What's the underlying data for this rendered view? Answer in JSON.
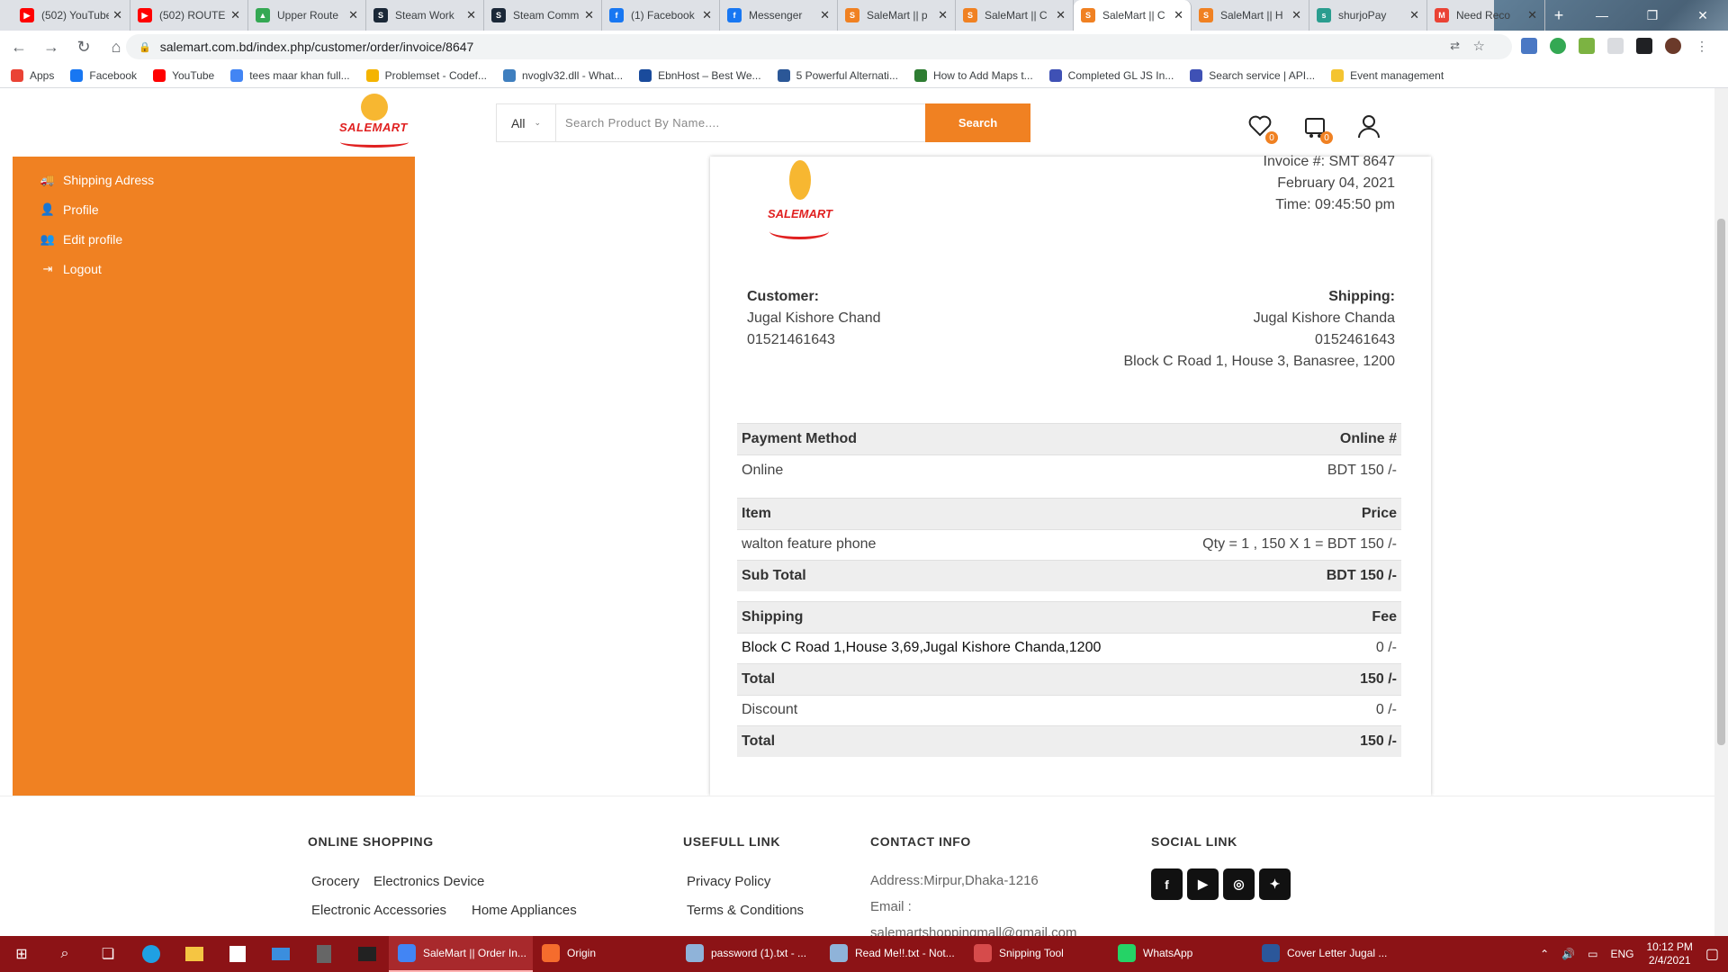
{
  "browser": {
    "tabs": [
      {
        "title": "(502) YouTube",
        "color": "#ff0000",
        "glyph": "▶"
      },
      {
        "title": "(502) ROUTE",
        "color": "#ff0000",
        "glyph": "▶"
      },
      {
        "title": "Upper Route",
        "color": "#34a853",
        "glyph": "▲"
      },
      {
        "title": "Steam Work",
        "color": "#1b2838",
        "glyph": "S"
      },
      {
        "title": "Steam Comm",
        "color": "#1b2838",
        "glyph": "S"
      },
      {
        "title": "(1) Facebook",
        "color": "#1877f2",
        "glyph": "f"
      },
      {
        "title": "Messenger",
        "color": "#1877f2",
        "glyph": "f"
      },
      {
        "title": "SaleMart || p",
        "color": "#f08122",
        "glyph": "S"
      },
      {
        "title": "SaleMart || C",
        "color": "#f08122",
        "glyph": "S"
      },
      {
        "title": "SaleMart || C",
        "color": "#f08122",
        "glyph": "S"
      },
      {
        "title": "SaleMart || H",
        "color": "#f08122",
        "glyph": "S"
      },
      {
        "title": "shurjoPay",
        "color": "#2a9d8f",
        "glyph": "s"
      },
      {
        "title": "Need Reco",
        "color": "#ea4335",
        "glyph": "M"
      }
    ],
    "active_tab_index": 9,
    "url": "salemart.com.bd/index.php/customer/order/invoice/8647",
    "bookmarks": [
      {
        "label": "Apps",
        "color": "#ea4335"
      },
      {
        "label": "Facebook",
        "color": "#1877f2"
      },
      {
        "label": "YouTube",
        "color": "#ff0000"
      },
      {
        "label": "tees maar khan full...",
        "color": "#4285f4"
      },
      {
        "label": "Problemset - Codef...",
        "color": "#f4b400"
      },
      {
        "label": "nvoglv32.dll - What...",
        "color": "#3f7fbf"
      },
      {
        "label": "EbnHost – Best We...",
        "color": "#1a4b9c"
      },
      {
        "label": "5 Powerful Alternati...",
        "color": "#2b5797"
      },
      {
        "label": "How to Add Maps t...",
        "color": "#2e7d32"
      },
      {
        "label": "Completed GL JS In...",
        "color": "#3f51b5"
      },
      {
        "label": "Search service | API...",
        "color": "#3f51b5"
      },
      {
        "label": "Event management",
        "color": "#f4c430"
      }
    ]
  },
  "header": {
    "logo_text": "SALEMART",
    "category_select": "All",
    "search_placeholder": "Search Product By Name....",
    "search_button": "Search",
    "wishlist_count": "0",
    "cart_count": "0"
  },
  "sidebar": {
    "items": [
      {
        "label": "Shipping Adress",
        "icon": "truck-icon",
        "glyph": "🚚"
      },
      {
        "label": "Profile",
        "icon": "user-icon",
        "glyph": "👤"
      },
      {
        "label": "Edit profile",
        "icon": "users-icon",
        "glyph": "👥"
      },
      {
        "label": "Logout",
        "icon": "logout-icon",
        "glyph": "⇥"
      }
    ]
  },
  "invoice": {
    "number": "Invoice #: SMT 8647",
    "date": "February 04, 2021",
    "time": "Time: 09:45:50 pm",
    "customer_heading": "Customer:",
    "customer_name": "Jugal Kishore Chand",
    "customer_phone": "01521461643",
    "shipping_heading": "Shipping:",
    "shipping_name": "Jugal Kishore Chanda",
    "shipping_phone": "0152461643",
    "shipping_address": "Block C Road 1, House 3, Banasree, 1200",
    "payment_table": {
      "header": [
        "Payment Method",
        "Online #"
      ],
      "row": [
        "Online",
        "BDT 150 /-"
      ]
    },
    "items_table": {
      "header": [
        "Item",
        "Price"
      ],
      "row": [
        "walton feature phone",
        "Qty = 1 , 150 X 1 = BDT 150 /-"
      ],
      "subtotal": [
        "Sub Total",
        "BDT 150 /-"
      ]
    },
    "shipping_table": {
      "header": [
        "Shipping",
        "Fee"
      ],
      "row": [
        "Block C Road 1,House 3,69,Jugal Kishore Chanda,1200",
        "0 /-"
      ],
      "total1": [
        "Total",
        "150 /-"
      ],
      "discount": [
        "Discount",
        "0 /-"
      ],
      "total2": [
        "Total",
        "150 /-"
      ]
    }
  },
  "footer": {
    "online_shopping": {
      "heading": "ONLINE SHOPPING",
      "links": [
        "Grocery",
        "Electronics Device",
        "Electronic Accessories",
        "Home Appliances"
      ]
    },
    "useful": {
      "heading": "USEFULL LINK",
      "links": [
        "Privacy Policy",
        "Terms & Conditions"
      ]
    },
    "contact": {
      "heading": "CONTACT INFO",
      "address": "Address:Mirpur,Dhaka-1216",
      "email_label": "Email :",
      "email": "salemartshoppingmall@gmail.com"
    },
    "social": {
      "heading": "SOCIAL LINK",
      "icons": [
        "facebook-icon",
        "youtube-icon",
        "instagram-icon",
        "twitter-icon"
      ]
    }
  },
  "taskbar": {
    "apps": [
      {
        "label": "SaleMart || Order In...",
        "color": "#4285f4",
        "active": true
      },
      {
        "label": "Origin",
        "color": "#f56c2d",
        "active": false
      },
      {
        "label": "password (1).txt - ...",
        "color": "#8fb3d9",
        "active": false
      },
      {
        "label": "Read Me!!.txt - Not...",
        "color": "#8fb3d9",
        "active": false
      },
      {
        "label": "Snipping Tool",
        "color": "#d64b4b",
        "active": false
      },
      {
        "label": "WhatsApp",
        "color": "#25d366",
        "active": false
      },
      {
        "label": "Cover Letter Jugal ...",
        "color": "#2b579a",
        "active": false
      }
    ],
    "lang": "ENG",
    "time": "10:12 PM",
    "date": "2/4/2021"
  }
}
